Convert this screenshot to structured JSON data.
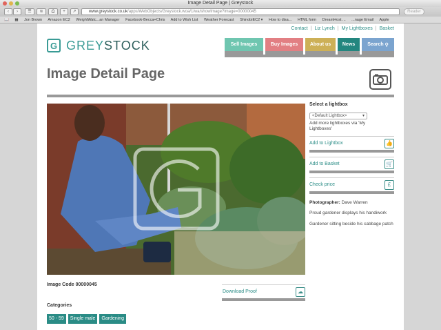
{
  "window": {
    "title": "Image Detail Page | Greystock"
  },
  "browser": {
    "url_host": "www.greystock.co.uk",
    "url_path": "/apps/WebObjects/Greystock.woa/1/wa/showImage?image=00000045",
    "reader_label": "Reader",
    "bookmarks": [
      "Jon Brown",
      "Amazon EC2",
      "WeightWatc...an Manager",
      "Facebook-Becca+Chris",
      "Add to Wish List",
      "Weather Forecast",
      "ShinobiEC2 ▾",
      "How to disa...",
      "HTML form",
      "DreamHost ...",
      "...nage Email",
      "Apple"
    ]
  },
  "header": {
    "utility_links": {
      "contact": "Contact",
      "user": "Liz Lynch",
      "lightboxes": "My Lightboxes",
      "basket": "Basket"
    },
    "logo": {
      "mark": "G",
      "text_a": "GREY",
      "text_b": "STOCK"
    },
    "nav": [
      {
        "label": "Sell Images",
        "color": "#6fc6b0"
      },
      {
        "label": "Buy Images",
        "color": "#e27f83"
      },
      {
        "label": "About us",
        "color": "#cdb057"
      },
      {
        "label": "News",
        "color": "#23867f"
      },
      {
        "label": "Search",
        "color": "#7ba4cf"
      }
    ]
  },
  "main": {
    "page_title": "Image Detail Page",
    "image_code": "Image Code 00000045",
    "download_label": "Download Proof",
    "categories_heading": "Categories",
    "categories": [
      "50 - 59",
      "Single male",
      "Gardening"
    ]
  },
  "sidebar": {
    "lightbox_label": "Select a lightbox",
    "lightbox_selected": "<Default Lightbox>",
    "lightbox_help": "Add more lightboxes via 'My Lightboxes'",
    "add_to_lightbox": "Add to Lightbox",
    "add_to_basket": "Add to Basket",
    "check_price": "Check price",
    "photographer_label": "Photographer:",
    "photographer_name": "Dave Warren",
    "caption": "Proud gardener displays his handiwork",
    "description": "Gardener sitting beside his cabbage patch"
  },
  "colors": {
    "teal": "#2a8c86",
    "rule_grey": "#999999"
  }
}
